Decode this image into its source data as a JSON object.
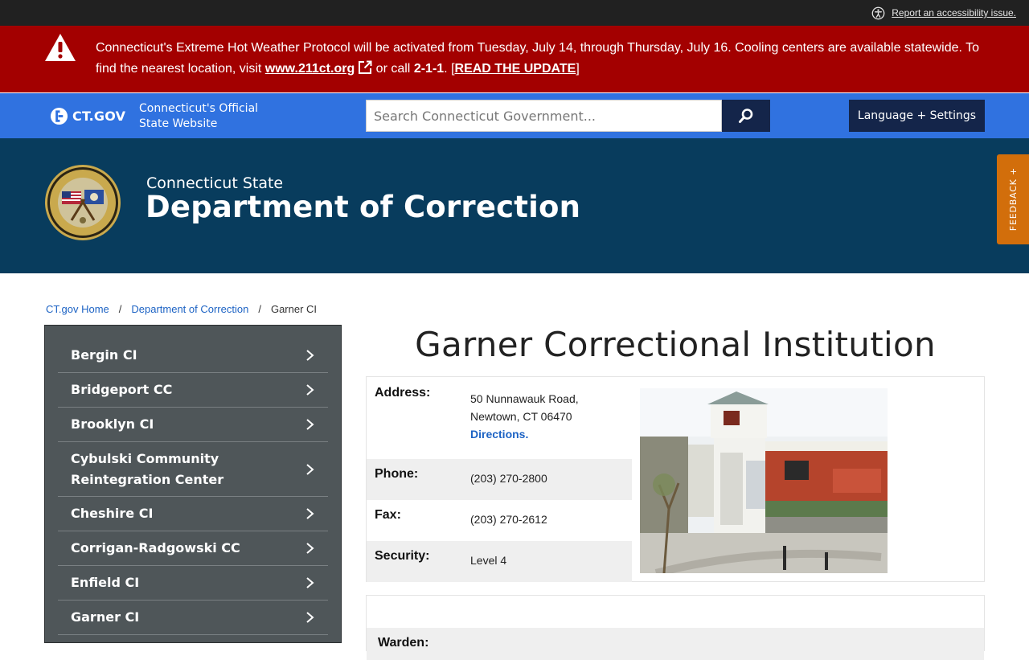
{
  "topbar": {
    "accessibility_link": "Report an accessibility issue."
  },
  "alert": {
    "text_1": "Connecticut's Extreme Hot Weather Protocol will be activated from Tuesday, July 14, through Thursday, July 16. Cooling centers are available statewide. To find the nearest location, visit ",
    "link": "www.211ct.org",
    "text_2": " or call ",
    "phone": "2-1-1",
    "text_3": ". [",
    "update_link": "READ THE UPDATE",
    "text_4": "]"
  },
  "header": {
    "logo": "CT.GOV",
    "official_line1": "Connecticut's Official",
    "official_line2": "State Website",
    "search_placeholder": "Search Connecticut Government...",
    "language_button": "Language + Settings"
  },
  "agency": {
    "subtitle": "Connecticut State",
    "title": "Department of Correction",
    "feedback": "FEEDBACK +"
  },
  "breadcrumb": {
    "home": "CT.gov Home",
    "sep": "/",
    "parent": "Department of Correction",
    "current": "Garner CI"
  },
  "sidebar": {
    "items": [
      {
        "label": "Bergin CI"
      },
      {
        "label": "Bridgeport CC"
      },
      {
        "label": "Brooklyn CI"
      },
      {
        "label": "Cybulski Community Reintegration Center"
      },
      {
        "label": "Cheshire CI"
      },
      {
        "label": "Corrigan-Radgowski CC"
      },
      {
        "label": "Enfield CI"
      },
      {
        "label": "Garner CI"
      },
      {
        "label": ""
      }
    ]
  },
  "main": {
    "title": "Garner Correctional Institution",
    "address_label": "Address:",
    "address_line1": "50 Nunnawauk Road,",
    "address_line2": "Newtown, CT 06470",
    "directions": "Directions.",
    "phone_label": "Phone:",
    "phone": "(203) 270-2800",
    "fax_label": "Fax:",
    "fax": "(203) 270-2612",
    "security_label": "Security:",
    "security": "Level 4",
    "warden_label": "Warden:"
  },
  "colors": {
    "alert_bg": "#a30000",
    "ctgov_bar": "#3072e0",
    "agency_banner": "#083c5d",
    "sidebar_bg": "#4f5659",
    "feedback_tab": "#d26e0b",
    "link": "#1d63c4"
  }
}
